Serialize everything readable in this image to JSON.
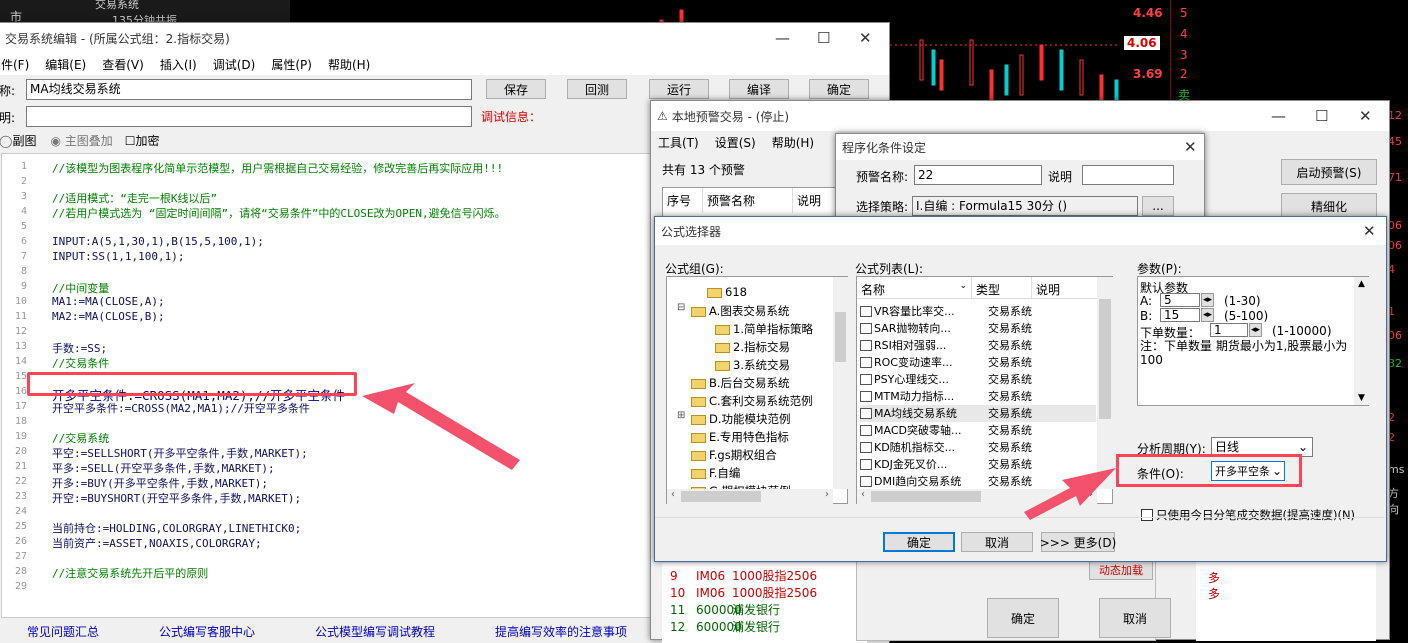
{
  "bg": {
    "topleft": [
      "市",
      "交易系统",
      "135分钟共振"
    ],
    "prices": [
      "4.46",
      "4.06",
      "3.69"
    ],
    "nums": [
      "5",
      "4",
      "3",
      "2",
      "卖"
    ],
    "right": [
      "12",
      "45",
      "71",
      "06",
      "06",
      "4",
      "1",
      "06",
      "32",
      "2",
      "2",
      "ms",
      "方向"
    ]
  },
  "editor": {
    "title": "交易系统编辑 - (所属公式组：2.指标交易)",
    "menu": [
      "件(F)",
      "编辑(E)",
      "查看(V)",
      "插入(I)",
      "调试(D)",
      "属性(P)",
      "帮助(H)"
    ],
    "name_label": "称:",
    "name_value": "MA均线交易系统",
    "desc_label": "明:",
    "debug_label": "调试信息：",
    "buttons": [
      "保存",
      "回测",
      "运行",
      "编译",
      "确定"
    ],
    "radio1": "副图",
    "radio2": "主图叠加",
    "check": "加密",
    "code": [
      {
        "n": "1",
        "t": "//该模型为图表程序化简单示范模型，用户需根据自己交易经验，修改完善后再实际应用!!!",
        "c": "cm"
      },
      {
        "n": "2",
        "t": ""
      },
      {
        "n": "3",
        "t": "//适用模式：“走完一根K线以后”",
        "c": "cm"
      },
      {
        "n": "4",
        "t": "//若用户模式选为 “固定时间间隔”，请将“交易条件”中的CLOSE改为OPEN,避免信号闪烁。",
        "c": "cm"
      },
      {
        "n": "5",
        "t": ""
      },
      {
        "n": "6",
        "t": "INPUT:A(5,1,30,1),B(15,5,100,1);",
        "c": "code"
      },
      {
        "n": "7",
        "t": "INPUT:SS(1,1,100,1);",
        "c": "code"
      },
      {
        "n": "8",
        "t": ""
      },
      {
        "n": "9",
        "t": "//中间变量",
        "c": "cm"
      },
      {
        "n": "10",
        "t": "MA1:=MA(CLOSE,A);",
        "c": "code"
      },
      {
        "n": "11",
        "t": "MA2:=MA(CLOSE,B);",
        "c": "code"
      },
      {
        "n": "12",
        "t": ""
      },
      {
        "n": "13",
        "t": "手数:=SS;",
        "c": "code"
      },
      {
        "n": "14",
        "t": "//交易条件",
        "c": "cm"
      },
      {
        "n": "15",
        "t": ""
      },
      {
        "n": "16",
        "t": "开多平空条件:=CROSS(MA1,MA2);//开多平空条件",
        "c": "hl"
      },
      {
        "n": "17",
        "t": "开空平多条件:=CROSS(MA2,MA1);//开空平多条件",
        "c": "code"
      },
      {
        "n": "18",
        "t": ""
      },
      {
        "n": "19",
        "t": "//交易系统",
        "c": "cm"
      },
      {
        "n": "20",
        "t": "平空:=SELLSHORT(开多平空条件,手数,MARKET);",
        "c": "code"
      },
      {
        "n": "21",
        "t": "平多:=SELL(开空平多条件,手数,MARKET);",
        "c": "code"
      },
      {
        "n": "22",
        "t": "开多:=BUY(开多平空条件,手数,MARKET);",
        "c": "code"
      },
      {
        "n": "23",
        "t": "开空:=BUYSHORT(开空平多条件,手数,MARKET);",
        "c": "code"
      },
      {
        "n": "24",
        "t": ""
      },
      {
        "n": "25",
        "t": "当前持仓:=HOLDING,COLORGRAY,LINETHICK0;",
        "c": "code"
      },
      {
        "n": "26",
        "t": "当前资产:=ASSET,NOAXIS,COLORGRAY;",
        "c": "code"
      },
      {
        "n": "27",
        "t": ""
      },
      {
        "n": "28",
        "t": "//注意交易系统先开后平的原则",
        "c": "cm"
      },
      {
        "n": "29",
        "t": ""
      }
    ],
    "bottom_links": [
      "常见问题汇总",
      "公式编写客服中心",
      "公式模型编写调试教程",
      "提高编写效率的注意事项"
    ]
  },
  "warn": {
    "title": "本地预警交易 - (停止)",
    "menu": [
      "工具(T)",
      "设置(S)",
      "帮助(H)"
    ],
    "count": "共有 13 个预警",
    "cols": [
      "序号",
      "预警名称",
      "说明"
    ],
    "btn_start": "启动预警(S)",
    "btn_refine": "精细化",
    "rows": [
      {
        "n": "9",
        "code": "IM06",
        "name": "1000股指2506"
      },
      {
        "n": "10",
        "code": "IM06",
        "name": "1000股指2506"
      },
      {
        "n": "11",
        "code": "600000",
        "name": "浦发银行"
      },
      {
        "n": "12",
        "code": "600000",
        "name": "浦发银行"
      }
    ],
    "dyn": "动态加载",
    "ok": "确定",
    "cancel": "取消",
    "extra": "多"
  },
  "cond": {
    "title": "程序化条件设定",
    "name_label": "预警名称:",
    "name_value": "22",
    "desc_label": "说明",
    "strategy_label": "选择策略:",
    "strategy_value": "I.自编 : Formula15 30分 ()",
    "dots": "..."
  },
  "selector": {
    "title": "公式选择器",
    "group_label": "公式组(G):",
    "list_label": "公式列表(L):",
    "param_label": "参数(P):",
    "groups": [
      "618",
      "A.图表交易系统",
      "1.简单指标策略",
      "2.指标交易",
      "3.系统交易",
      "B.后台交易系统",
      "C.套利交易系统范例",
      "D.功能模块范例",
      "E.专用特色指标",
      "F.gs期权组合",
      "F.自编",
      "G.期权模块范例"
    ],
    "cols": [
      "名称",
      "类型",
      "说明"
    ],
    "formulas": [
      [
        "VR容量比率交...",
        "交易系统"
      ],
      [
        "SAR抛物转向...",
        "交易系统"
      ],
      [
        "RSI相对强弱...",
        "交易系统"
      ],
      [
        "ROC变动速率...",
        "交易系统"
      ],
      [
        "PSY心理线交...",
        "交易系统"
      ],
      [
        "MTM动力指标...",
        "交易系统"
      ],
      [
        "MA均线交易系统",
        "交易系统"
      ],
      [
        "MACD突破零轴...",
        "交易系统"
      ],
      [
        "KD随机指标交...",
        "交易系统"
      ],
      [
        "KDJ金死叉价...",
        "交易系统"
      ],
      [
        "DMI趋向交易系统",
        "交易系统"
      ]
    ],
    "params": {
      "default": "默认参数",
      "a_label": "A:",
      "a_val": "5",
      "a_range": "(1-30)",
      "b_label": "B:",
      "b_val": "15",
      "b_range": "(5-100)",
      "lot_label": "下单数量：",
      "lot_val": "1",
      "lot_range": "(1-10000)",
      "note": "注：下单数量 期货最小为1,股票最小为100"
    },
    "period_label": "分析周期(Y):",
    "period_value": "日线",
    "cond_label": "条件(O):",
    "cond_value": "开多平空条",
    "tick_label": "只使用今日分笔成交数据(提高速度)(N)",
    "ok": "确定",
    "cancel": "取消",
    "more": ">>> 更多(D)"
  }
}
